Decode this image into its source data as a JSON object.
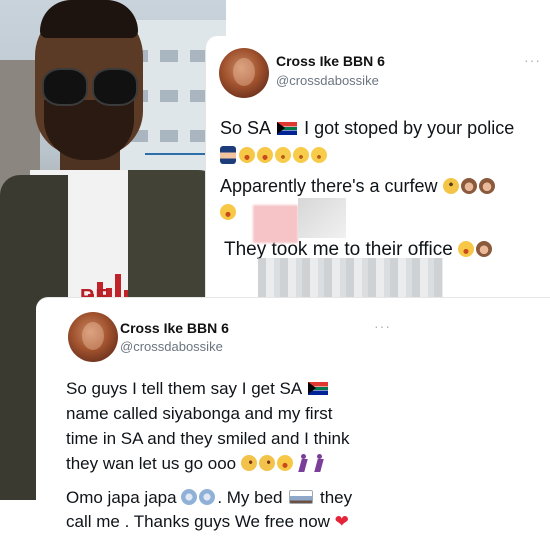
{
  "tweet1": {
    "display_name": "Cross Ike BBN 6",
    "handle": "@crossdabossike",
    "more": "···",
    "lines": [
      "So SA",
      "I got stoped by your police",
      "Apparently there's a curfew",
      "They took me to their office"
    ]
  },
  "tweet2": {
    "display_name": "Cross Ike BBN 6",
    "handle": "@crossdabossike",
    "more": "···",
    "lines": [
      "So guys I tell them say I get SA",
      "name called siyabonga and my first",
      "time in SA and they smiled and I think",
      "they wan let us go ooo",
      "Omo japa japa",
      ".  My bed",
      "they",
      "call me . Thanks guys We free now"
    ]
  },
  "photo": {
    "shirt_text": "RE"
  },
  "icons": {
    "flag": "south-africa-flag-icon",
    "police": "police-officer-icon",
    "laugh": "tears-of-joy-icon",
    "plead": "pleading-face-icon",
    "monkey": "see-no-evil-monkey-icon",
    "zany": "zany-face-icon",
    "dancer": "dancing-person-icon",
    "dash": "dashing-away-icon",
    "bed": "bed-icon",
    "heart": "red-heart-icon"
  },
  "colors": {
    "text": "#0f1419",
    "handle": "#6b7580",
    "heart": "#e5243a"
  }
}
